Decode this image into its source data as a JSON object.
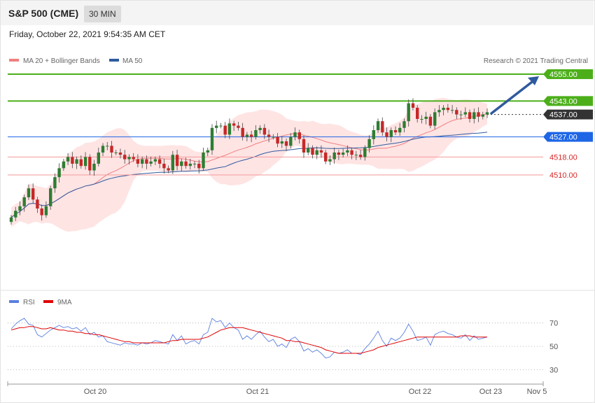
{
  "header": {
    "instrument": "S&P 500 (CME)",
    "timeframe": "30 MIN",
    "datetime": "Friday, October 22, 2021 9:54:35 AM CET"
  },
  "legend": {
    "ma20": {
      "label": "MA 20 + Bollinger Bands",
      "color": "#f08080"
    },
    "ma50": {
      "label": "MA 50",
      "color": "#2f5a9e"
    },
    "copyright": "Research © 2021 Trading Central"
  },
  "rsi_legend": {
    "rsi": {
      "label": "RSI",
      "color": "#5b7fe0"
    },
    "ma9": {
      "label": "9MA",
      "color": "#e00000"
    }
  },
  "colors": {
    "bull": "#2e7d32",
    "bear": "#c62828",
    "green_level": "#4caf1a",
    "blue_level": "#1e66e6",
    "red_level": "#f29a9a",
    "band_fill": "#ffe4e4",
    "arrow": "#2f5a9e",
    "current": "#333333"
  },
  "chart_data": [
    {
      "type": "candlestick",
      "title": "S&P 500 (CME)",
      "timeframe": "30 MIN",
      "ylim": [
        4460,
        4560
      ],
      "x_tick_labels": [
        "Oct 20",
        "Oct 21",
        "Oct 22",
        "Oct 23",
        "Nov 5"
      ],
      "levels": [
        {
          "value": 4555.0,
          "label": "4555.00",
          "kind": "resistance",
          "style": "green-box"
        },
        {
          "value": 4543.0,
          "label": "4543.00",
          "kind": "resistance",
          "style": "green-box"
        },
        {
          "value": 4537.0,
          "label": "4537.00",
          "kind": "current",
          "style": "dark-box"
        },
        {
          "value": 4527.0,
          "label": "4527.00",
          "kind": "pivot",
          "style": "blue-box"
        },
        {
          "value": 4518.0,
          "label": "4518.00",
          "kind": "support",
          "style": "red-text"
        },
        {
          "value": 4510.0,
          "label": "4510.00",
          "kind": "support",
          "style": "red-text"
        }
      ],
      "arrow": {
        "from": 4537.5,
        "to": 4555.0,
        "direction": "up"
      },
      "close": [
        4491,
        4494,
        4496,
        4500,
        4504,
        4499,
        4495,
        4492,
        4496,
        4504,
        4509,
        4513,
        4516,
        4518,
        4515,
        4517,
        4514,
        4518,
        4512,
        4515,
        4520,
        4523,
        4523,
        4520,
        4520,
        4519,
        4517,
        4518,
        4517,
        4515,
        4517,
        4515,
        4516,
        4517,
        4515,
        4513,
        4512,
        4519,
        4514,
        4516,
        4514,
        4515,
        4515,
        4513,
        4520,
        4521,
        4531,
        4532,
        4532,
        4528,
        4533,
        4532,
        4531,
        4527,
        4528,
        4527,
        4530,
        4531,
        4528,
        4527,
        4527,
        4524,
        4525,
        4523,
        4527,
        4529,
        4526,
        4520,
        4522,
        4519,
        4521,
        4520,
        4516,
        4517,
        4520,
        4519,
        4520,
        4521,
        4519,
        4519,
        4518,
        4522,
        4526,
        4530,
        4534,
        4529,
        4527,
        4530,
        4529,
        4531,
        4534,
        4542,
        4540,
        4535,
        4535,
        4536,
        4532,
        4538,
        4539,
        4540,
        4539,
        4539,
        4537,
        4537,
        4538,
        4535,
        4538,
        4536,
        4537,
        4538
      ],
      "series": [
        {
          "name": "MA 20",
          "role": "ma20"
        },
        {
          "name": "MA 50",
          "role": "ma50"
        }
      ]
    },
    {
      "type": "line",
      "title": "RSI",
      "ylim": [
        20,
        80
      ],
      "y_ticks": [
        30,
        50,
        70
      ],
      "series": [
        {
          "name": "RSI",
          "values": [
            65,
            69,
            72,
            74,
            69,
            68,
            60,
            58,
            61,
            64,
            66,
            68,
            66,
            67,
            65,
            66,
            63,
            66,
            60,
            62,
            58,
            59,
            54,
            53,
            52,
            51,
            53,
            52,
            52,
            51,
            53,
            52,
            53,
            55,
            54,
            53,
            52,
            60,
            55,
            59,
            52,
            54,
            55,
            52,
            60,
            62,
            74,
            71,
            72,
            66,
            70,
            66,
            64,
            56,
            59,
            56,
            60,
            63,
            58,
            54,
            56,
            50,
            52,
            49,
            56,
            58,
            54,
            46,
            48,
            45,
            47,
            44,
            40,
            41,
            45,
            44,
            45,
            47,
            44,
            44,
            43,
            48,
            52,
            57,
            63,
            55,
            50,
            57,
            55,
            57,
            62,
            69,
            63,
            55,
            56,
            58,
            51,
            60,
            62,
            63,
            61,
            60,
            58,
            57,
            60,
            55,
            59,
            56,
            57,
            58
          ]
        },
        {
          "name": "9MA",
          "values": [
            64,
            65,
            66,
            66,
            67,
            67,
            66,
            65,
            65,
            66,
            65,
            64,
            64,
            63,
            63,
            62,
            62,
            61,
            61,
            60,
            60,
            59,
            58,
            57,
            56,
            55,
            54,
            54,
            53,
            53,
            53,
            53,
            53,
            53,
            53,
            53,
            54,
            55,
            55,
            56,
            56,
            56,
            56,
            56,
            57,
            58,
            60,
            62,
            64,
            65,
            66,
            66,
            66,
            66,
            65,
            64,
            63,
            62,
            61,
            60,
            59,
            58,
            57,
            55,
            55,
            54,
            54,
            53,
            52,
            51,
            50,
            49,
            47,
            46,
            45,
            44,
            44,
            44,
            44,
            44,
            44,
            45,
            46,
            47,
            49,
            50,
            51,
            52,
            53,
            54,
            55,
            56,
            57,
            58,
            58,
            58,
            58,
            58,
            58,
            58,
            58,
            58,
            58,
            59,
            59,
            59,
            58,
            58,
            58,
            58
          ]
        }
      ]
    }
  ]
}
